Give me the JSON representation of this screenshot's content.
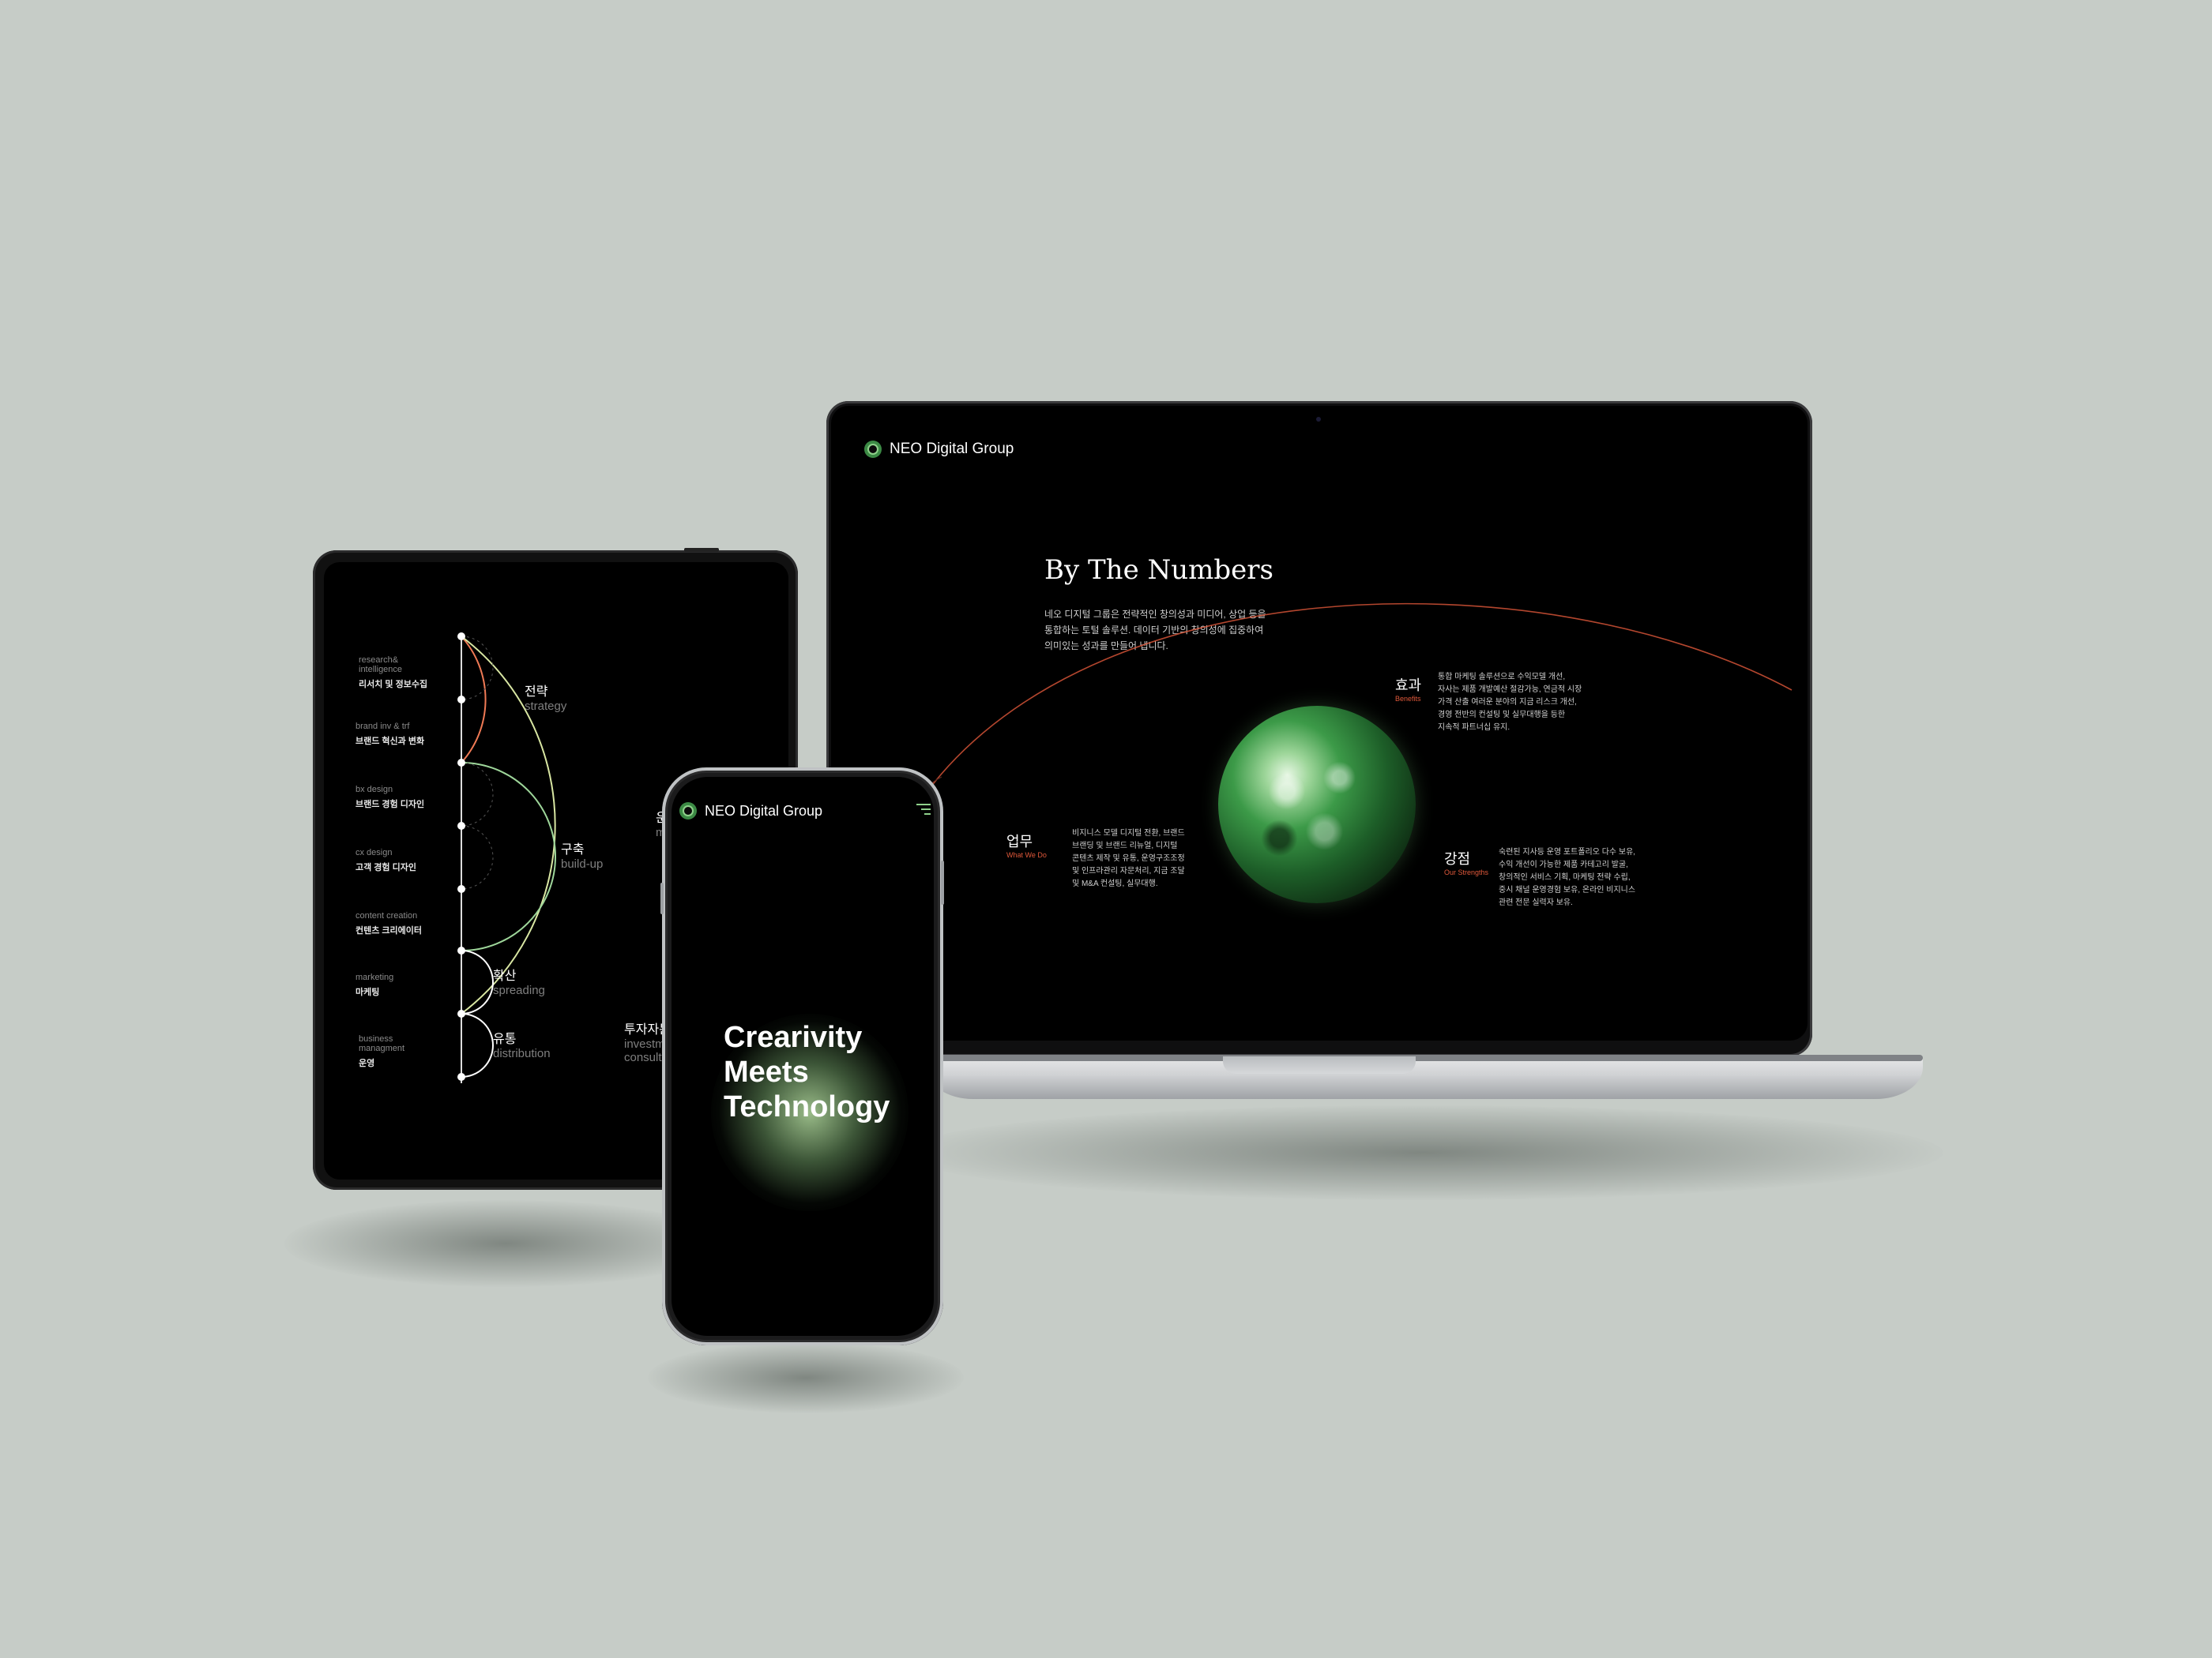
{
  "brand": {
    "name": "NEO Digital Group"
  },
  "laptop": {
    "title": "By The Numbers",
    "intro": [
      "네오 디지털 그룹은 전략적인 창의성과 미디어, 상업 등을",
      "통합하는 토털 솔루션. 데이터 기반의 창의성에 집중하여",
      "의미있는 성과를 만들어 냅니다."
    ],
    "blocks": [
      {
        "ko": "업무",
        "en": "What We Do",
        "lines": [
          "비지니스 모델 디지털 전환, 브랜드",
          "브랜딩 및 브랜드 리뉴얼, 디지털",
          "콘텐츠 제작 및 유통, 운영구조조정",
          "및 인프라관리 자문처리, 지금 조달",
          "및 M&A 컨설팅, 실무대행."
        ]
      },
      {
        "ko": "효과",
        "en": "Benefits",
        "lines": [
          "통합 마케팅 솔루션으로 수익모델 개선,",
          "자사는 제품 개발예산 절감가능, 연금적 시장",
          "가격 산출 여러운 분야의 지금 리스크 개선,",
          "경영 전반의 컨설팅 및 실무대행을 등한",
          "지속적 파트너십 유지."
        ]
      },
      {
        "ko": "강점",
        "en": "Our Strengths",
        "lines": [
          "숙련된 지사등 운영 포트폴리오 다수 보유,",
          "수익 개선이 가능한 제품 카테고리 발굴,",
          "창의적인 서비스 기획, 마케팅 전략 수립,",
          "중시 채널 운영경험 보유, 온라인 비지니스",
          "관련 전문 실력자 보유."
        ]
      }
    ]
  },
  "tablet": {
    "left_labels": [
      {
        "en": "research&\nintelligence",
        "ko": "리서치 및 정보수집"
      },
      {
        "en": "brand inv & trf",
        "ko": "브랜드 혁신과 변화"
      },
      {
        "en": "bx design",
        "ko": "브랜드 경험 디자인"
      },
      {
        "en": "cx design",
        "ko": "고객 경험 디자인"
      },
      {
        "en": "content creation",
        "ko": "컨텐츠 크리에이터"
      },
      {
        "en": "marketing",
        "ko": "마케팅"
      },
      {
        "en": "business\nmanagment",
        "ko": "운영"
      }
    ],
    "stages": [
      {
        "ko": "전략",
        "en": "strategy"
      },
      {
        "ko": "구축",
        "en": "build-up"
      },
      {
        "ko": "확산",
        "en": "spreading"
      },
      {
        "ko": "유통",
        "en": "distribution"
      },
      {
        "ko": "운",
        "en": "m"
      },
      {
        "ko": "투자자문",
        "en": "investme"
      },
      {
        "ko": "",
        "en": "consulti"
      }
    ]
  },
  "phone": {
    "hero": [
      "Crearivity",
      "Meets",
      "Technology"
    ],
    "menu_icon": "hamburger-icon"
  },
  "colors": {
    "accent_orange": "#e0583a",
    "accent_green": "#8fd18b",
    "background": "#c6ccc7"
  }
}
